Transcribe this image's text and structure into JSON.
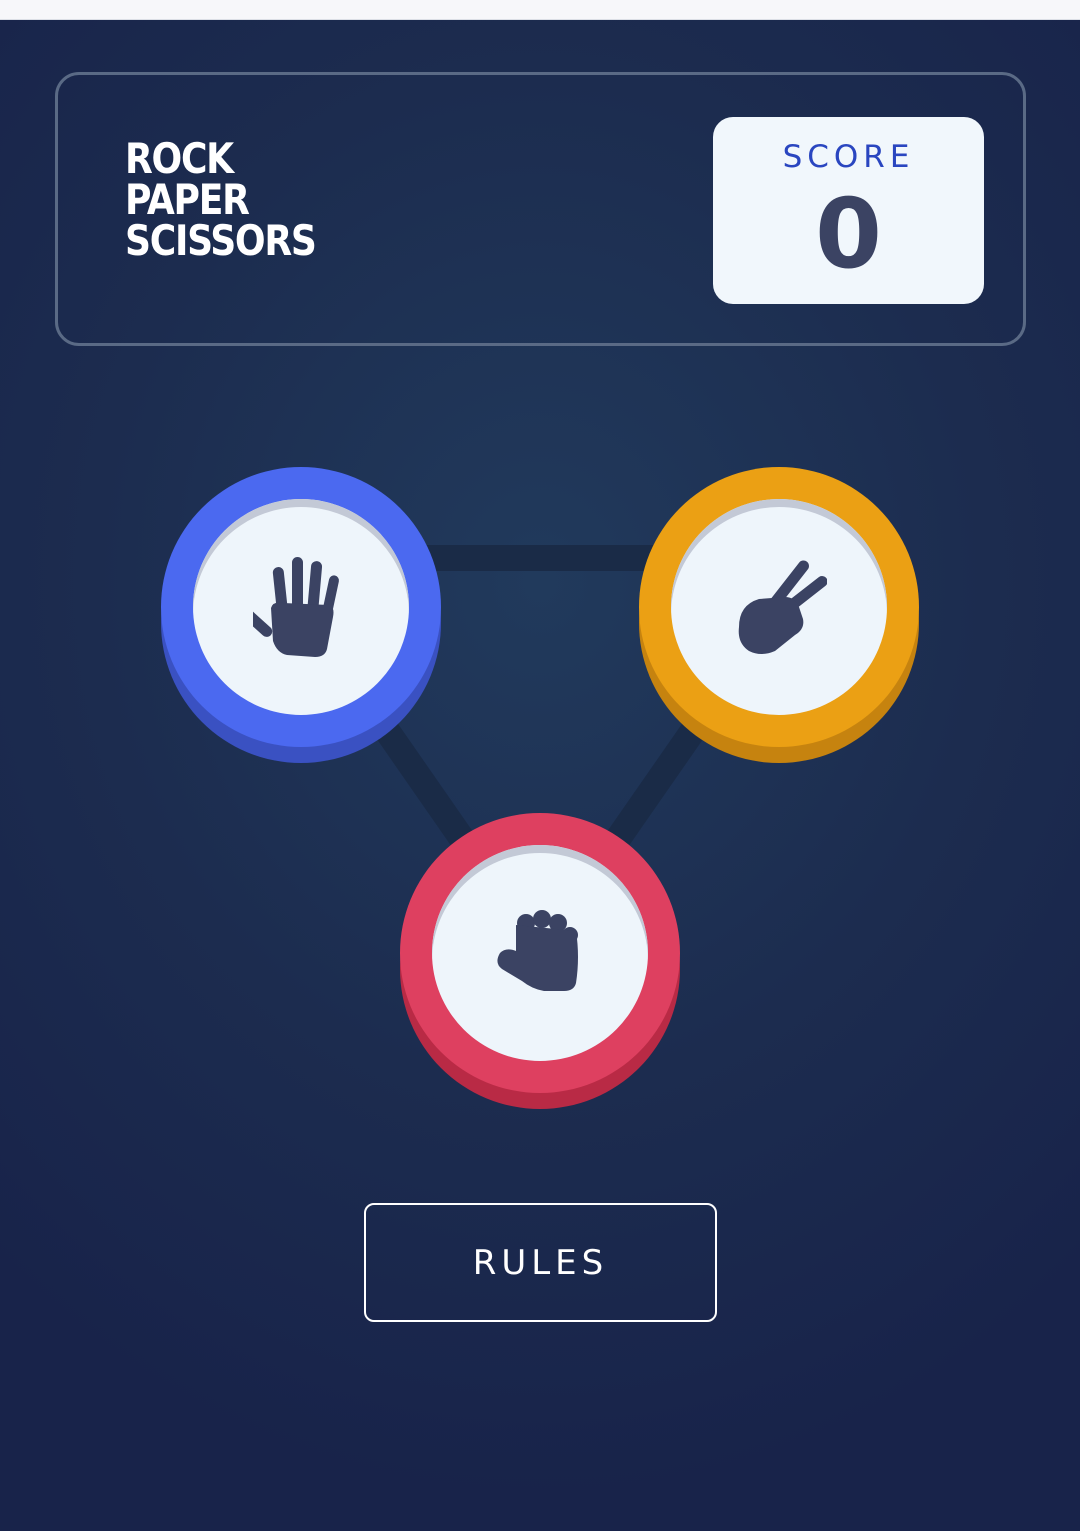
{
  "header": {
    "title_lines": [
      "ROCK",
      "PAPER",
      "SCISSORS"
    ],
    "score_label": "SCORE",
    "score_value": "0"
  },
  "choices": [
    {
      "id": "paper",
      "icon": "paper-hand-icon",
      "ring_color": "#4b69f0",
      "shadow_color": "#3a51c2"
    },
    {
      "id": "scissors",
      "icon": "scissors-hand-icon",
      "ring_color": "#eba014",
      "shadow_color": "#c6830f"
    },
    {
      "id": "rock",
      "icon": "rock-fist-icon",
      "ring_color": "#de4060",
      "shadow_color": "#b92a45"
    }
  ],
  "rules_button": {
    "label": "RULES"
  },
  "colors": {
    "background": "#1c2c4f",
    "header_border": "#5a6a85",
    "score_label": "#2a46c0",
    "score_value": "#3b4363",
    "token_face": "#eef5fb",
    "icon": "#3b4363"
  }
}
